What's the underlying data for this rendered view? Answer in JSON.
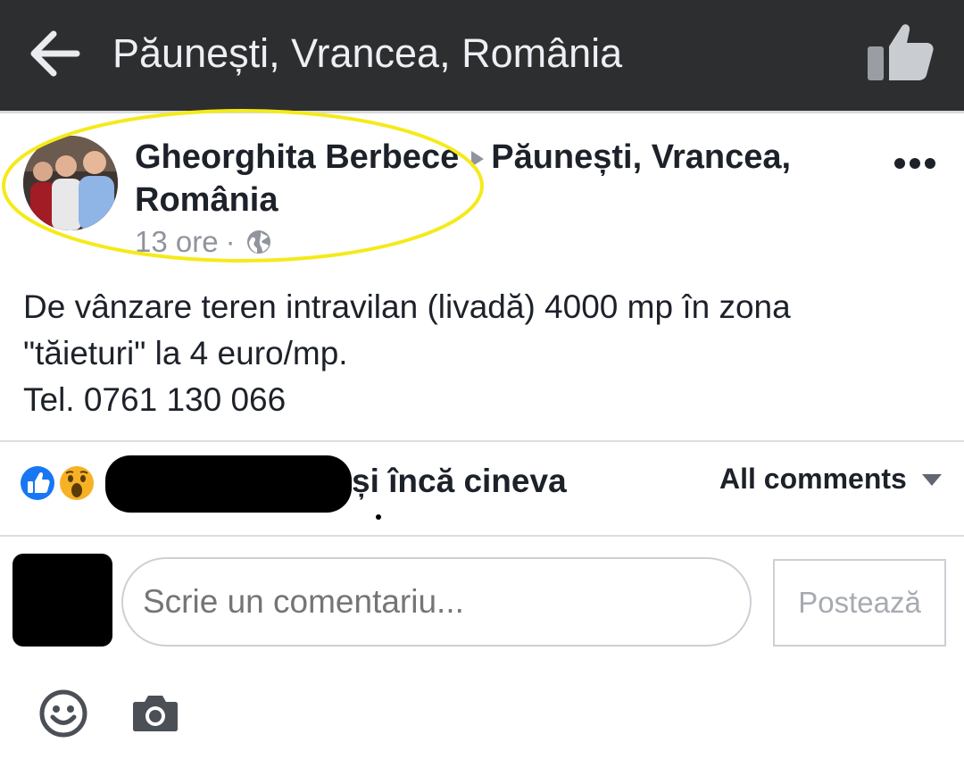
{
  "header": {
    "title": "Păunești, Vrancea, România",
    "back_icon": "arrow-left-icon",
    "like_icon": "thumbs-up-icon"
  },
  "post": {
    "author": "Gheorghita Berbece",
    "location_line1": "Păunești, Vrancea,",
    "location_line2": "România",
    "time": "13 ore",
    "separator": "·",
    "privacy_icon": "globe-icon",
    "more_icon": "more-dots-icon",
    "body_lines": [
      "De vânzare teren intravilan (livadă) 4000 mp în zona",
      "\"tăieturi\" la 4 euro/mp.",
      "Tel. 0761 130 066"
    ]
  },
  "reactions": {
    "icons": [
      "like-reaction-icon",
      "wow-reaction-icon"
    ],
    "text": "și încă cineva",
    "filter_label": "All comments"
  },
  "composer": {
    "placeholder": "Scrie un comentariu...",
    "post_label": "Postează"
  },
  "colors": {
    "topbar_bg": "#2d2e2f",
    "like_blue": "#1877f2",
    "wow_yellow": "#f7b125",
    "highlight": "#f5ea1a",
    "muted_text": "#90949c"
  }
}
